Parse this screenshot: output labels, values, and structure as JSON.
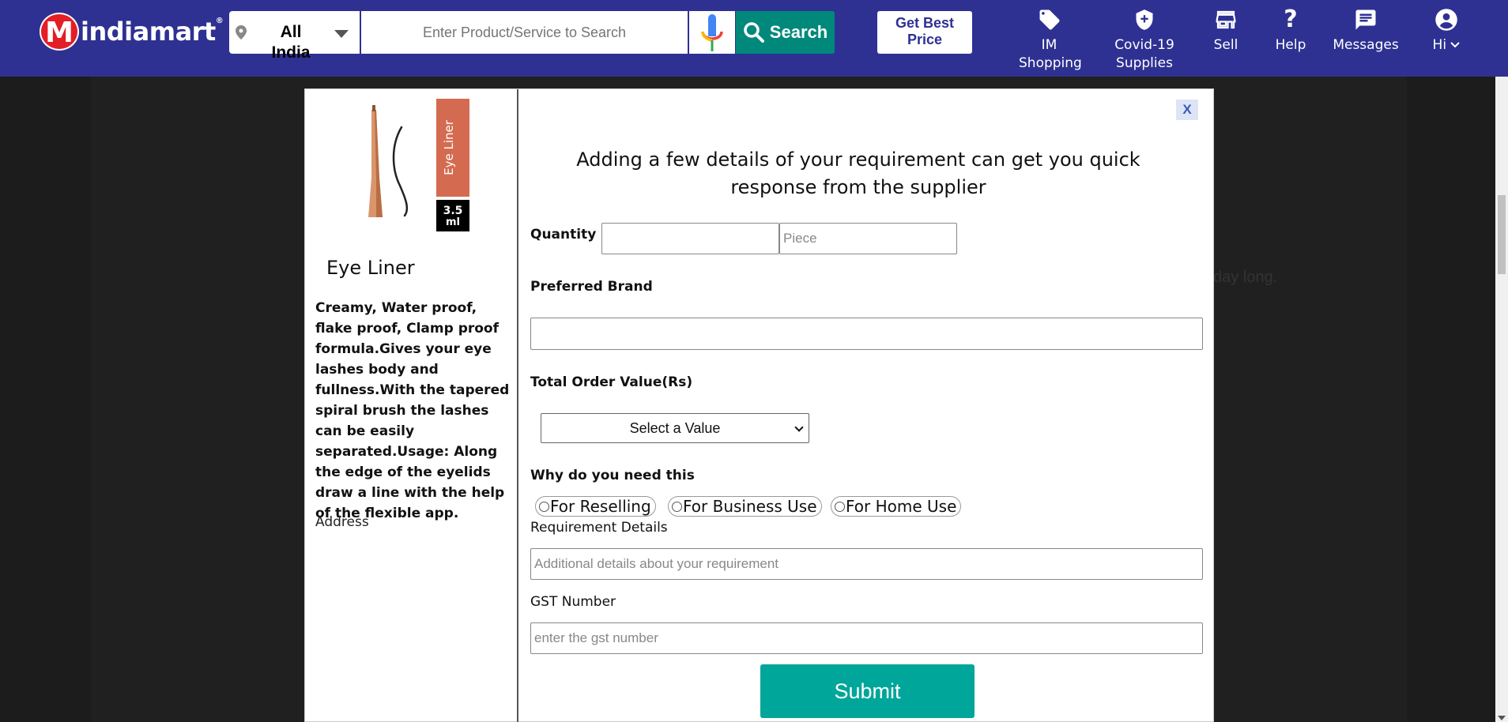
{
  "header": {
    "logo_text": "indiamart",
    "logo_mark": "M",
    "logo_reg": "®",
    "location": "All India",
    "search_placeholder": "Enter Product/Service to Search",
    "search_button": "Search",
    "best_price_line1": "Get Best",
    "best_price_line2": "Price",
    "nav": [
      {
        "label1": "IM",
        "label2": "Shopping",
        "icon": "tag-icon"
      },
      {
        "label1": "Covid-19",
        "label2": "Supplies",
        "icon": "shield-plus-icon"
      },
      {
        "label1": "Sell",
        "label2": "",
        "icon": "store-icon"
      },
      {
        "label1": "Help",
        "label2": "",
        "icon": "question-icon"
      },
      {
        "label1": "Messages",
        "label2": "",
        "icon": "message-icon"
      },
      {
        "label1": "Hi",
        "label2": "",
        "icon": "account-icon"
      }
    ],
    "colors": {
      "bar": "#2e3192",
      "search_button": "#00897b",
      "logo_red": "#e31e24"
    }
  },
  "background": {
    "text_fragment": "day long."
  },
  "product": {
    "image_label": "Eye Liner",
    "image_size": "3.5 ml",
    "image_size_line1": "3.5",
    "image_size_line2": "ml",
    "title": "Eye Liner",
    "description": "Creamy, Water proof, flake proof, Clamp proof formula.Gives your eye lashes body and fullness.With the tapered spiral brush the lashes can be easily separated.Usage: Along the edge of the eyelids draw a line with the help of the flexible app.",
    "address_label": "Address"
  },
  "form": {
    "close": "X",
    "heading": "Adding a few details of your requirement can get you quick response from the supplier",
    "quantity_label": "Quantity",
    "quantity_value": "",
    "unit_placeholder": "Piece",
    "brand_label": "Preferred Brand",
    "brand_value": "",
    "order_value_label": "Total Order Value(Rs)",
    "order_value_selected": "Select a Value",
    "why_label": "Why do you need this",
    "purpose_options": [
      "For Reselling",
      "For Business Use",
      "For Home Use"
    ],
    "requirement_label": "Requirement Details",
    "requirement_placeholder": "Additional details about your requirement",
    "gst_label": "GST Number",
    "gst_placeholder": "enter the gst number",
    "submit": "Submit",
    "colors": {
      "submit": "#00a699"
    }
  }
}
